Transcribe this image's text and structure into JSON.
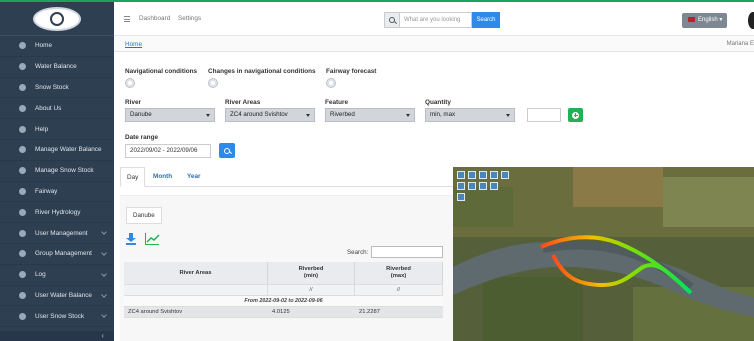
{
  "topbar": {
    "links": [
      "Dashboard",
      "Settings"
    ],
    "search_placeholder": "What are you looking",
    "search_button": "Search",
    "language": "English"
  },
  "sidebar": {
    "items": [
      {
        "label": "Home",
        "has_children": false
      },
      {
        "label": "Water Balance",
        "has_children": false
      },
      {
        "label": "Snow Stock",
        "has_children": false
      },
      {
        "label": "About Us",
        "has_children": false
      },
      {
        "label": "Help",
        "has_children": false
      },
      {
        "label": "Manage Water Balance",
        "has_children": false
      },
      {
        "label": "Manage Snow Stock",
        "has_children": false
      },
      {
        "label": "Fairway",
        "has_children": false
      },
      {
        "label": "River Hydrology",
        "has_children": false
      },
      {
        "label": "User Management",
        "has_children": true
      },
      {
        "label": "Group Management",
        "has_children": true
      },
      {
        "label": "Log",
        "has_children": true
      },
      {
        "label": "User Water Balance",
        "has_children": true
      },
      {
        "label": "User Snow Stock",
        "has_children": true
      }
    ]
  },
  "breadcrumb": {
    "home": "Home",
    "user": "Mariana E"
  },
  "toggles": [
    {
      "label": "Navigational conditions"
    },
    {
      "label": "Changes in navigational conditions"
    },
    {
      "label": "Fairway forecast"
    }
  ],
  "filters": {
    "river": {
      "label": "River",
      "value": "Danube"
    },
    "area": {
      "label": "River Areas",
      "value": "ZC4 around Svishtov"
    },
    "feature": {
      "label": "Feature",
      "value": "Riverbed"
    },
    "quantity": {
      "label": "Quantity",
      "value": "min, max"
    }
  },
  "date_range": {
    "label": "Date range",
    "value": "2022/09/02 - 2022/09/06"
  },
  "tabs": [
    "Day",
    "Month",
    "Year"
  ],
  "river_tab": "Danube",
  "table": {
    "search_label": "Search:",
    "headers": [
      "River Areas",
      "Riverbed\n(min)",
      "Riverbed\n(max)"
    ],
    "filter_values": [
      "",
      "//",
      "//"
    ],
    "period": "From 2022-09-02 to 2022-09-06",
    "rows": [
      {
        "area": "ZC4 around Svishtov",
        "min": "4.0125",
        "max": "21.2287"
      }
    ]
  },
  "map": {
    "route_colors": [
      "#00e060",
      "#7ee000",
      "#f0c000",
      "#ff4a1a"
    ]
  }
}
